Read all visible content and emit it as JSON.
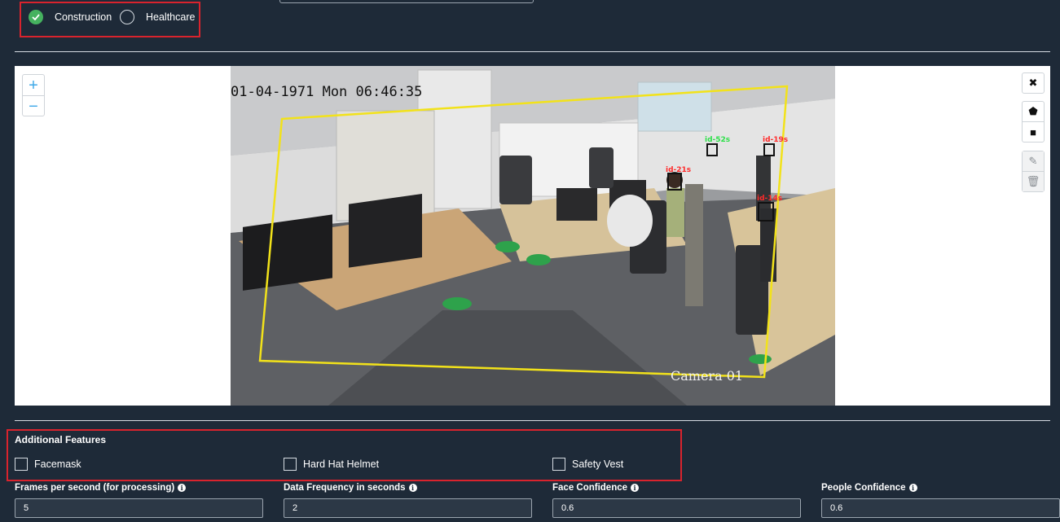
{
  "industry": {
    "options": [
      {
        "label": "Construction",
        "selected": true
      },
      {
        "label": "Healthcare",
        "selected": false
      }
    ]
  },
  "editor": {
    "zoom_in": "+",
    "zoom_out": "−",
    "camera": {
      "timestamp": "01-04-1971 Mon 06:46:35",
      "caption": "Camera 01",
      "detections": [
        {
          "label": "id-52s",
          "color": "#2ee04a"
        },
        {
          "label": "id-19s",
          "color": "#ff2a2a"
        },
        {
          "label": "id-21s",
          "color": "#ff2a2a"
        },
        {
          "label": "id-14s",
          "color": "#ff2a2a"
        }
      ]
    },
    "tools": {
      "close_icon": "close-icon",
      "polygon_icon": "pentagon-icon",
      "rectangle_icon": "square-icon",
      "edit_icon": "edit-icon",
      "delete_icon": "trash-icon"
    }
  },
  "additional_features": {
    "title": "Additional Features",
    "items": [
      {
        "label": "Facemask",
        "checked": false
      },
      {
        "label": "Hard Hat Helmet",
        "checked": false
      },
      {
        "label": "Safety Vest",
        "checked": false
      }
    ]
  },
  "fields": [
    {
      "label": "Frames per second (for processing)",
      "value": "5"
    },
    {
      "label": "Data Frequency in seconds",
      "value": "2"
    },
    {
      "label": "Face Confidence",
      "value": "0.6"
    },
    {
      "label": "People Confidence",
      "value": "0.6"
    }
  ],
  "colors": {
    "background": "#1e2a38",
    "highlight": "#d9232d",
    "selected": "#45b25f",
    "zone": "#f2e21a"
  }
}
